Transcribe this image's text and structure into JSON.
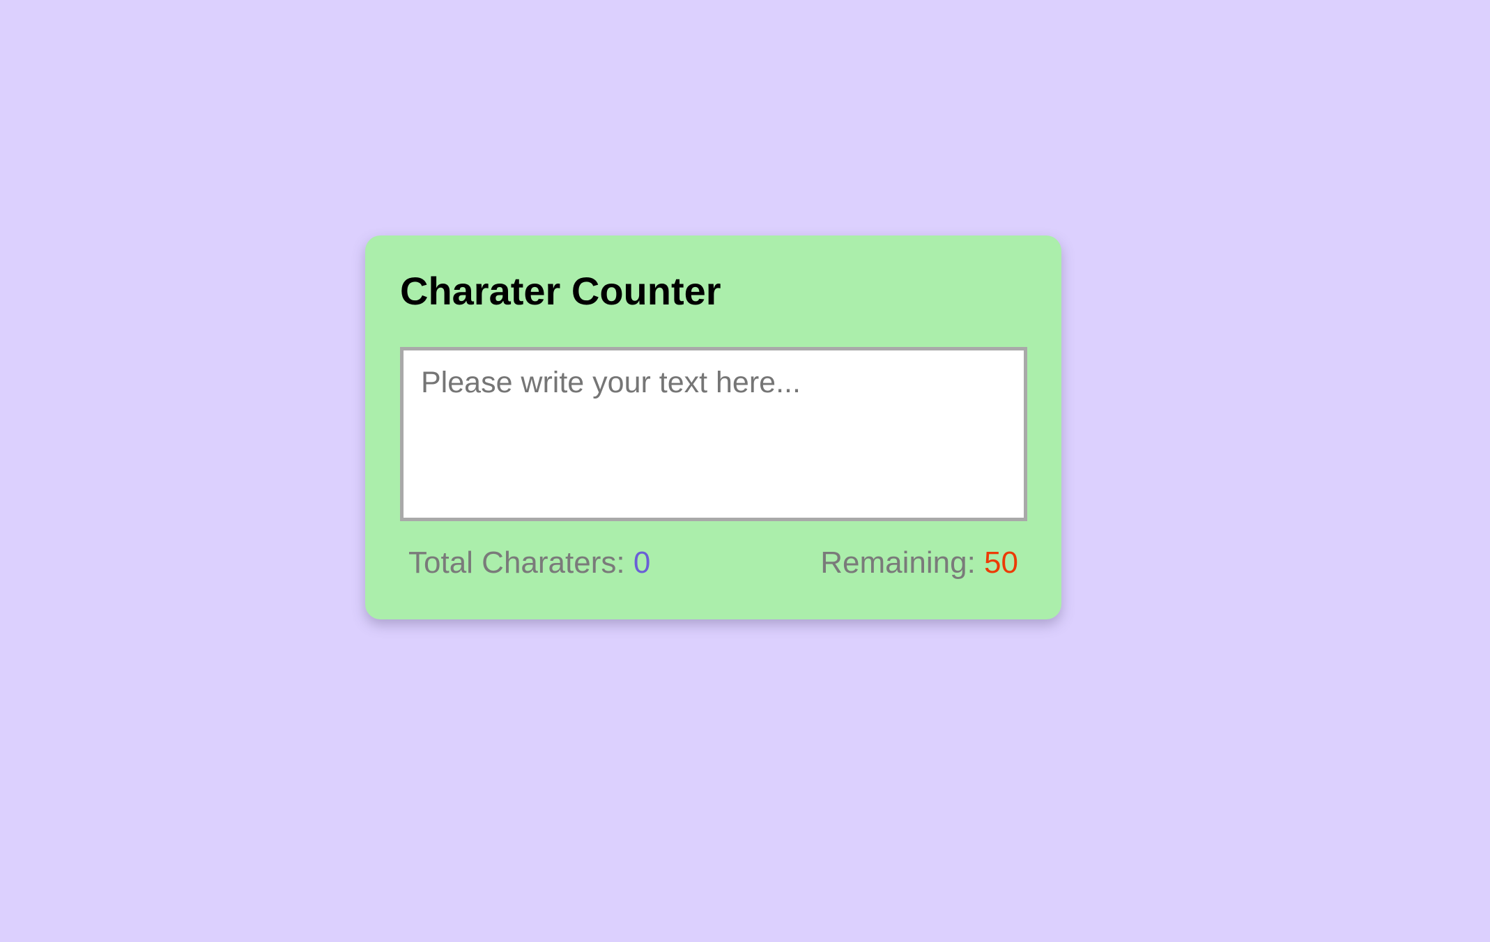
{
  "app": {
    "title": "Charater Counter"
  },
  "textarea": {
    "value": "",
    "placeholder": "Please write your text here..."
  },
  "stats": {
    "total_label": "Total Charaters: ",
    "total_value": "0",
    "remaining_label": "Remaining: ",
    "remaining_value": "50"
  },
  "colors": {
    "background": "#dcd0fe",
    "card": "#abeeab",
    "total_value": "#6a5fd6",
    "remaining_value": "#ec3b05"
  }
}
